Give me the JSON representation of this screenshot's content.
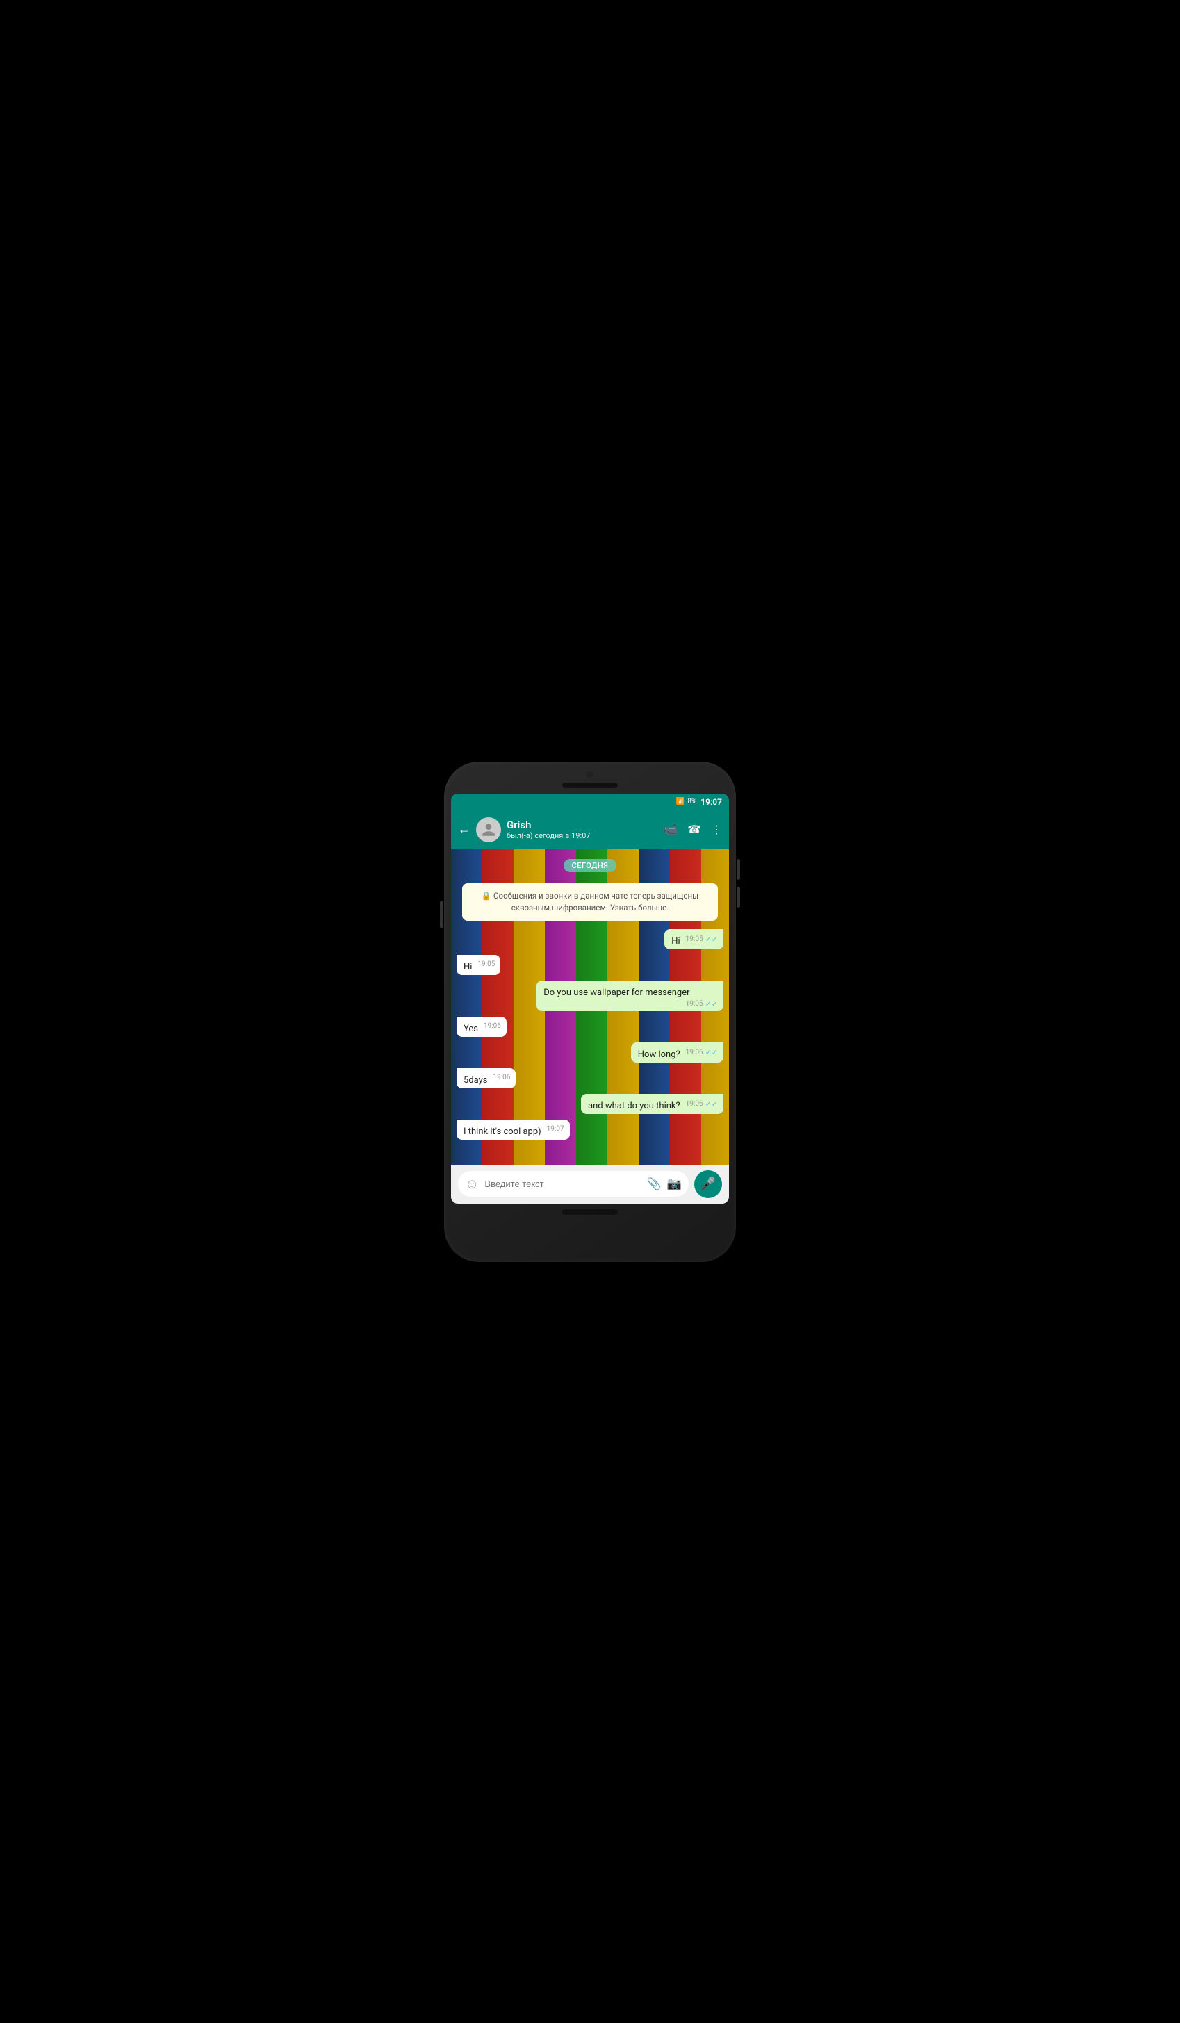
{
  "status_bar": {
    "wifi": "wifi",
    "signal": "signal",
    "battery": "8%",
    "time": "19:07"
  },
  "header": {
    "back_label": "←",
    "contact_name": "Grish",
    "contact_status": "был(-а) сегодня в 19:07",
    "video_icon": "video",
    "call_icon": "call",
    "more_icon": "more"
  },
  "chat": {
    "date_badge": "СЕГОДНЯ",
    "encryption_notice": "🔒 Сообщения и звонки в данном чате теперь защищены сквозным шифрованием. Узнать больше.",
    "messages": [
      {
        "id": 1,
        "direction": "outgoing",
        "text": "Hi",
        "time": "19:05",
        "ticks": "✓✓"
      },
      {
        "id": 2,
        "direction": "incoming",
        "text": "Hi",
        "time": "19:05",
        "ticks": ""
      },
      {
        "id": 3,
        "direction": "outgoing",
        "text": "Do you use wallpaper for messenger",
        "time": "19:05",
        "ticks": "✓✓"
      },
      {
        "id": 4,
        "direction": "incoming",
        "text": "Yes",
        "time": "19:06",
        "ticks": ""
      },
      {
        "id": 5,
        "direction": "outgoing",
        "text": "How long?",
        "time": "19:06",
        "ticks": "✓✓"
      },
      {
        "id": 6,
        "direction": "incoming",
        "text": "5days",
        "time": "19:06",
        "ticks": ""
      },
      {
        "id": 7,
        "direction": "outgoing",
        "text": "and what do you think?",
        "time": "19:06",
        "ticks": "✓✓"
      },
      {
        "id": 8,
        "direction": "incoming",
        "text": "I think it's cool app)",
        "time": "19:07",
        "ticks": ""
      }
    ]
  },
  "input": {
    "placeholder": "Введите текст",
    "emoji_symbol": "☺",
    "attach_symbol": "📎",
    "camera_symbol": "📷",
    "mic_symbol": "🎤"
  }
}
